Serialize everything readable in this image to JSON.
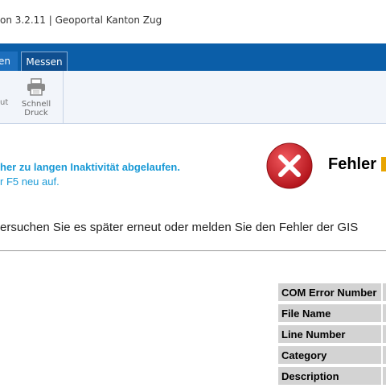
{
  "header": {
    "app_title": "on 3.2.11   |   Geoportal Kanton Zug"
  },
  "nav": {
    "tabs": [
      "en",
      "Messen"
    ]
  },
  "toolbar": {
    "partial_label": "ut",
    "print_label": "Schnell\nDruck"
  },
  "error": {
    "message_line1": "her zu langen Inaktivität abgelaufen.",
    "message_line2": "r F5 neu auf.",
    "title": "Fehler",
    "instructions": "ersuchen Sie es später erneut oder melden Sie den Fehler der GIS",
    "details_labels": [
      "COM Error Number",
      "File Name",
      "Line Number",
      "Category",
      "Description"
    ]
  },
  "colors": {
    "nav_blue": "#0b5ea8",
    "message_blue": "#1a9ad6",
    "error_red": "#d21f26",
    "accent": "#e8a400"
  }
}
